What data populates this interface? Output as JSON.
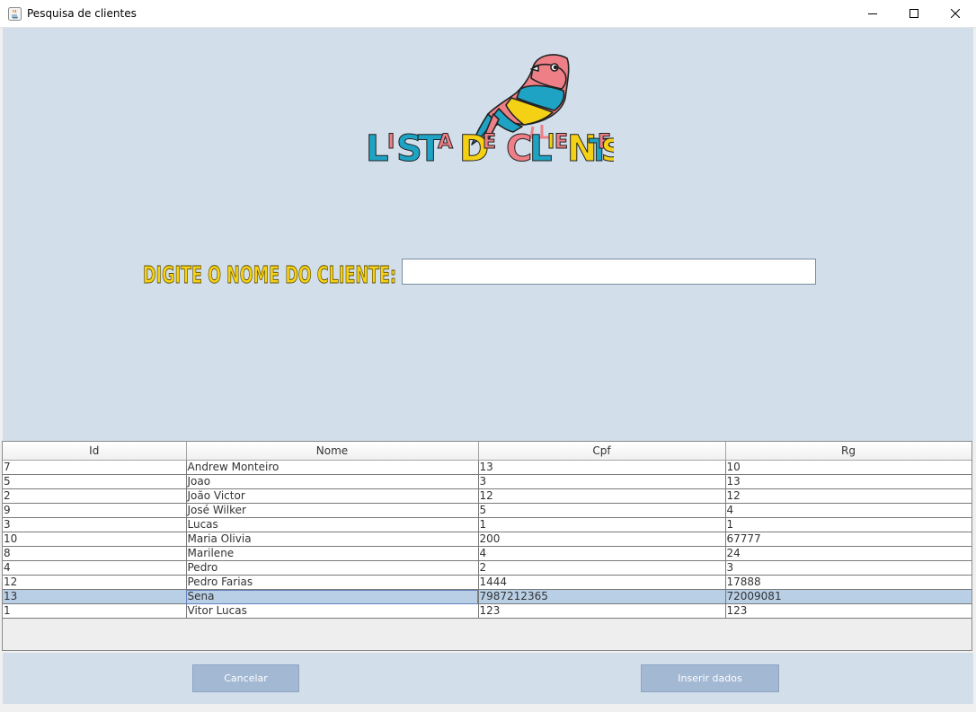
{
  "window": {
    "title": "Pesquisa de clientes"
  },
  "header": {
    "logo_text": "LISTA DE CLIENTES"
  },
  "search": {
    "label": "DIGITE O NOME DO CLIENTE:",
    "value": "",
    "placeholder": ""
  },
  "table": {
    "columns": [
      "Id",
      "Nome",
      "Cpf",
      "Rg"
    ],
    "rows": [
      [
        "7",
        "Andrew Monteiro",
        "13",
        "10"
      ],
      [
        "5",
        "Joao",
        "3",
        "13"
      ],
      [
        "2",
        "João Victor",
        "12",
        "12"
      ],
      [
        "9",
        "José Wilker",
        "5",
        "4"
      ],
      [
        "3",
        "Lucas",
        "1",
        "1"
      ],
      [
        "10",
        "Maria Olivia",
        "200",
        "67777"
      ],
      [
        "8",
        "Marilene",
        "4",
        "24"
      ],
      [
        "4",
        "Pedro",
        "2",
        "3"
      ],
      [
        "12",
        "Pedro Farias",
        "1444",
        "17888"
      ],
      [
        "13",
        "Sena",
        "7987212365",
        "72009081"
      ],
      [
        "1",
        "Vitor Lucas",
        "123",
        "123"
      ]
    ],
    "selected_row": 9
  },
  "buttons": {
    "cancel": "Cancelar",
    "insert": "Inserir dados"
  },
  "colors": {
    "panel_bg": "#d2dfeb",
    "button_bg": "#a3b8d3",
    "selection": "#b8cfe5",
    "logo_blue": "#1fa3c4",
    "logo_yellow": "#f5d116",
    "logo_pink": "#ef7f87"
  }
}
